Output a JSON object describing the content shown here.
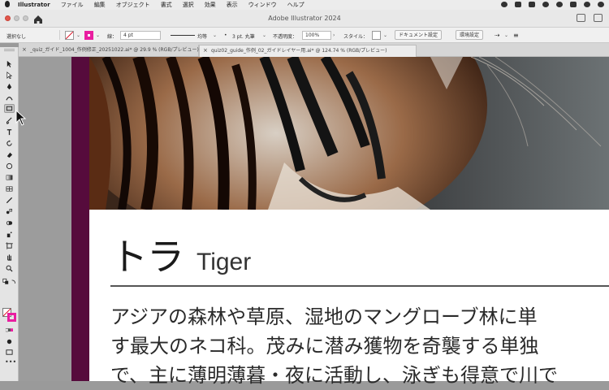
{
  "menubar": {
    "app": "Illustrator",
    "items": [
      "ファイル",
      "編集",
      "オブジェクト",
      "書式",
      "選択",
      "効果",
      "表示",
      "ウィンドウ",
      "ヘルプ"
    ]
  },
  "titlebar": {
    "title": "Adobe Illustrator 2024"
  },
  "controlbar": {
    "selection": "選択なし",
    "stroke_label": "線：",
    "stroke_weight": "4 pt",
    "profile": "均等",
    "brush": "3 pt. 丸筆",
    "opacity_label": "不透明度：",
    "opacity": "100%",
    "style_label": "スタイル：",
    "document_setup": "ドキュメント設定",
    "preferences": "環境設定"
  },
  "tabs": [
    {
      "label": "_quiz_ガイド_1004_作例修正_20251022.ai* @ 29.9 % (RGB/プレビュー)",
      "active": false
    },
    {
      "label": "quiz02_guide_作例_02_ガイドレイヤー用.ai* @ 124.74 % (RGB/プレビュー)",
      "active": true
    }
  ],
  "artboard": {
    "heading_jp": "トラ",
    "heading_en": "Tiger",
    "body_line1": "アジアの森林や草原、湿地のマングローブ林に単",
    "body_line2": "す最大のネコ科。茂みに潜み獲物を奇襲する単独",
    "body_line3": "で、主に薄明薄暮・夜に活動し、泳ぎも得意で川で"
  },
  "colors": {
    "fill_accent": "#e91ea0",
    "bleed": "#560b3c"
  },
  "icons": [
    "apple-logo-icon",
    "home-icon",
    "selection-tool-icon",
    "direct-selection-tool-icon",
    "pen-tool-icon",
    "curvature-tool-icon",
    "rectangle-tool-icon",
    "paintbrush-tool-icon",
    "type-tool-icon",
    "rotate-tool-icon",
    "eraser-tool-icon",
    "gradient-tool-icon",
    "eyedropper-tool-icon",
    "blend-tool-icon",
    "shape-builder-tool-icon",
    "artboard-tool-icon",
    "hand-tool-icon",
    "zoom-tool-icon"
  ]
}
